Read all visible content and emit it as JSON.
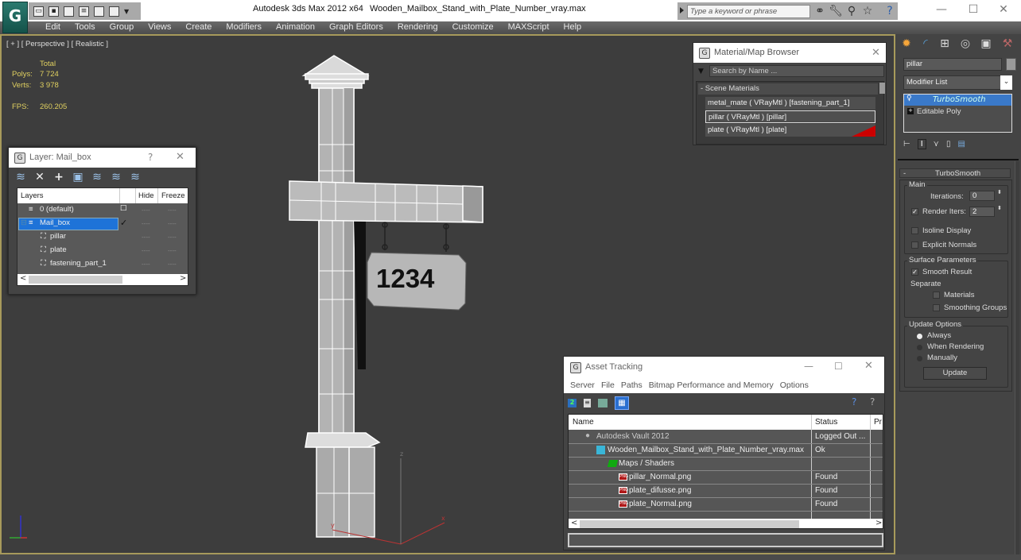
{
  "app": {
    "title": "Autodesk 3ds Max  2012 x64",
    "file_name": "Wooden_Mailbox_Stand_with_Plate_Number_vray.max",
    "logo_glyph": "G"
  },
  "quick_access": {
    "icons": [
      "open-icon",
      "save-icon",
      "new-icon",
      "project-icon",
      "undo-icon",
      "redo-icon",
      "dropdown-icon"
    ]
  },
  "search": {
    "placeholder": "Type a keyword or phrase",
    "icons": [
      "binoculars-icon",
      "wrench-icon",
      "satellite-icon",
      "star-icon",
      "help-icon"
    ]
  },
  "window_controls": {
    "minimize": "—",
    "maximize": "☐",
    "close": "✕"
  },
  "menubar": [
    "Edit",
    "Tools",
    "Group",
    "Views",
    "Create",
    "Modifiers",
    "Animation",
    "Graph Editors",
    "Rendering",
    "Customize",
    "MAXScript",
    "Help"
  ],
  "viewport": {
    "label": "[ + ] [ Perspective ] [ Realistic ]",
    "stats": {
      "total_label": "Total",
      "polys_label": "Polys:",
      "polys_value": "7 724",
      "verts_label": "Verts:",
      "verts_value": "3 978",
      "fps_label": "FPS:",
      "fps_value": "260.205"
    },
    "plate_number": "1234",
    "axis": {
      "x": "x",
      "y": "y",
      "z": "z"
    }
  },
  "layer_dialog": {
    "title": "Layer: Mail_box",
    "help": "?",
    "close": "✕",
    "columns": [
      "Layers",
      "",
      "Hide",
      "Freeze"
    ],
    "rows": [
      {
        "name": "0 (default)",
        "indent": 1,
        "selected": false,
        "current": "☐",
        "hide": "----",
        "freeze": "----"
      },
      {
        "name": "Mail_box",
        "indent": 1,
        "selected": true,
        "current": "✓",
        "hide": "----",
        "freeze": "----"
      },
      {
        "name": "pillar",
        "indent": 2,
        "selected": false,
        "current": "",
        "hide": "----",
        "freeze": "----"
      },
      {
        "name": "plate",
        "indent": 2,
        "selected": false,
        "current": "",
        "hide": "----",
        "freeze": "----"
      },
      {
        "name": "fastening_part_1",
        "indent": 2,
        "selected": false,
        "current": "",
        "hide": "----",
        "freeze": "----"
      }
    ],
    "scroll_left": "<",
    "scroll_right": ">"
  },
  "material_browser": {
    "title": "Material/Map Browser",
    "close": "✕",
    "search_placeholder": "Search by Name ...",
    "section": "- Scene Materials",
    "materials": [
      "metal_mate  ( VRayMtl ) [fastening_part_1]",
      "pillar  ( VRayMtl ) [pillar]",
      "plate  ( VRayMtl ) [plate]"
    ]
  },
  "command_panel": {
    "object_name": "pillar",
    "object_color": "#9a9a9a",
    "modifier_list": "Modifier List",
    "stack": [
      {
        "name": "TurboSmooth",
        "selected": true
      },
      {
        "name": "Editable Poly",
        "selected": false
      }
    ],
    "rollout": {
      "title": "TurboSmooth",
      "collapse": "-",
      "main_label": "Main",
      "iterations_label": "Iterations:",
      "iterations_value": "0",
      "render_iters_label": "Render Iters:",
      "render_iters_value": "2",
      "render_iters_checked": true,
      "isoline_label": "Isoline Display",
      "isoline_checked": false,
      "explicit_normals_label": "Explicit Normals",
      "explicit_normals_checked": false,
      "surface_label": "Surface Parameters",
      "smooth_result_label": "Smooth Result",
      "smooth_result_checked": true,
      "separate_label": "Separate",
      "materials_label": "Materials",
      "smoothing_groups_label": "Smoothing Groups",
      "update_options_label": "Update Options",
      "update_always": "Always",
      "update_rendering": "When Rendering",
      "update_manually": "Manually",
      "selected_update": "Always",
      "update_button": "Update"
    }
  },
  "asset_tracking": {
    "title": "Asset Tracking",
    "min": "—",
    "max": "☐",
    "close": "✕",
    "menu": [
      "Server",
      "File",
      "Paths",
      "Bitmap Performance and Memory",
      "Options"
    ],
    "columns": [
      "Name",
      "Status",
      "Pr"
    ],
    "rows": [
      {
        "name": "Autodesk Vault 2012",
        "status": "Logged Out ...",
        "icon": "vault-icon",
        "indent": 0
      },
      {
        "name": "Wooden_Mailbox_Stand_with_Plate_Number_vray.max",
        "status": "Ok",
        "icon": "max-file-icon",
        "indent": 1
      },
      {
        "name": "Maps / Shaders",
        "status": "",
        "icon": "maps-folder-icon",
        "indent": 2
      },
      {
        "name": "pillar_Normal.png",
        "status": "Found",
        "icon": "png-icon",
        "indent": 3
      },
      {
        "name": "plate_difusse.png",
        "status": "Found",
        "icon": "png-icon",
        "indent": 3
      },
      {
        "name": "plate_Normal.png",
        "status": "Found",
        "icon": "png-icon",
        "indent": 3
      }
    ],
    "scroll_left": "<",
    "scroll_right": ">"
  }
}
